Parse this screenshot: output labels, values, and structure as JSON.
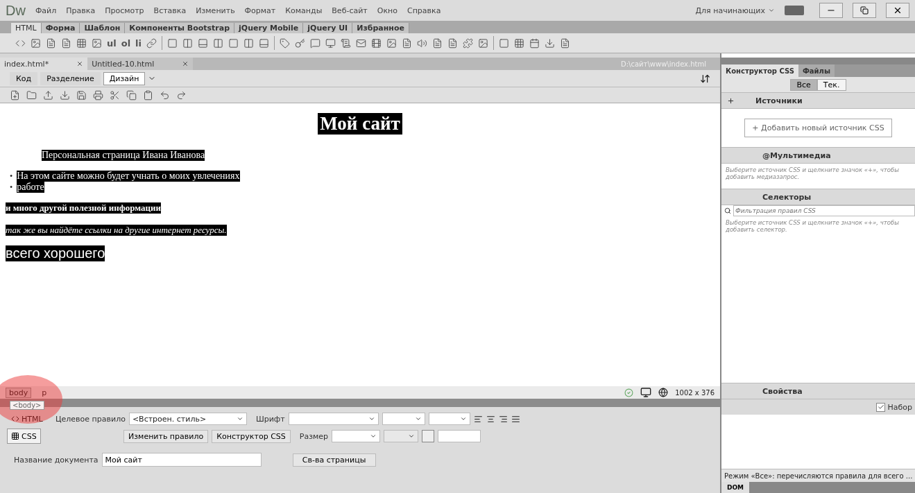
{
  "app": {
    "logo": "Dw",
    "menu": [
      "Файл",
      "Правка",
      "Просмотр",
      "Вставка",
      "Изменить",
      "Формат",
      "Команды",
      "Веб-сайт",
      "Окно",
      "Справка"
    ],
    "workspace": "Для начинающих"
  },
  "insert_bar": {
    "tabs": [
      {
        "label": "HTML",
        "selected": true
      },
      {
        "label": "Форма",
        "selected": false
      },
      {
        "label": "Шаблон",
        "selected": false
      },
      {
        "label": "Компоненты Bootstrap",
        "selected": false
      },
      {
        "label": "jQuery Mobile",
        "selected": false
      },
      {
        "label": "jQuery UI",
        "selected": false
      },
      {
        "label": "Избранное",
        "selected": false
      }
    ],
    "text_buttons": [
      "ul",
      "ol",
      "li"
    ]
  },
  "documents": {
    "tabs": [
      {
        "label": "index.html*",
        "selected": true
      },
      {
        "label": "Untitled-10.html",
        "selected": false
      }
    ],
    "path": "D:\\сайт\\www\\index.html"
  },
  "view_buttons": [
    {
      "label": "Код",
      "selected": false
    },
    {
      "label": "Разделение",
      "selected": false
    },
    {
      "label": "Дизайн",
      "selected": true
    }
  ],
  "page": {
    "heading": "Мой сайт",
    "intro": "Персональная страница Ивана Иванова",
    "list": [
      {
        "bullet": "•",
        "text": "На этом сайте можно будет учнать о моих увлечениях"
      },
      {
        "bullet": "•",
        "text": "работе"
      }
    ],
    "bold_text": "и много другой полезной информации",
    "italic_text": "так же вы найдёте ссылки на другие интернет ресурсы.",
    "closing": "всего хорошего"
  },
  "status_bar": {
    "tags": [
      {
        "label": "body",
        "selected": true
      },
      {
        "label": "p",
        "selected": false
      }
    ],
    "tooltip": "<body>",
    "size": "1002 x 376"
  },
  "properties": {
    "modes": [
      {
        "label": "HTML",
        "selected": false
      },
      {
        "label": "CSS",
        "selected": true
      }
    ],
    "target_rule_label": "Целевое правило",
    "target_rule": "<Встроен. стиль>",
    "buttons": [
      "Изменить правило",
      "Конструктор CSS"
    ],
    "font_label": "Шрифт",
    "size_label": "Размер",
    "title_label": "Название документа",
    "title_value": "Мой сайт",
    "page_props": "Св-ва страницы"
  },
  "css_panel": {
    "tabs": [
      {
        "label": "Конструктор CSS",
        "selected": true
      },
      {
        "label": "Файлы",
        "selected": false
      }
    ],
    "toggle": [
      {
        "label": "Все",
        "selected": true
      },
      {
        "label": "Тек.",
        "selected": false
      }
    ],
    "sources_title": "Источники",
    "add_source": "+ Добавить новый источник CSS",
    "media_title": "@Мультимедиа",
    "media_hint": "Выберите источник CSS и щелкните значок «+», чтобы добавить медиазапрос.",
    "selectors_title": "Селекторы",
    "filter_placeholder": "Фильтрация правил CSS",
    "selectors_hint": "Выберите источник CSS и щелкните значок «+», чтобы добавить селектор.",
    "properties_title": "Свойства",
    "set_label": "Набор",
    "set_checked": true,
    "footer": "Режим «Все»: перечисляются правила для всего ...",
    "bottom_tab": "DOM"
  }
}
